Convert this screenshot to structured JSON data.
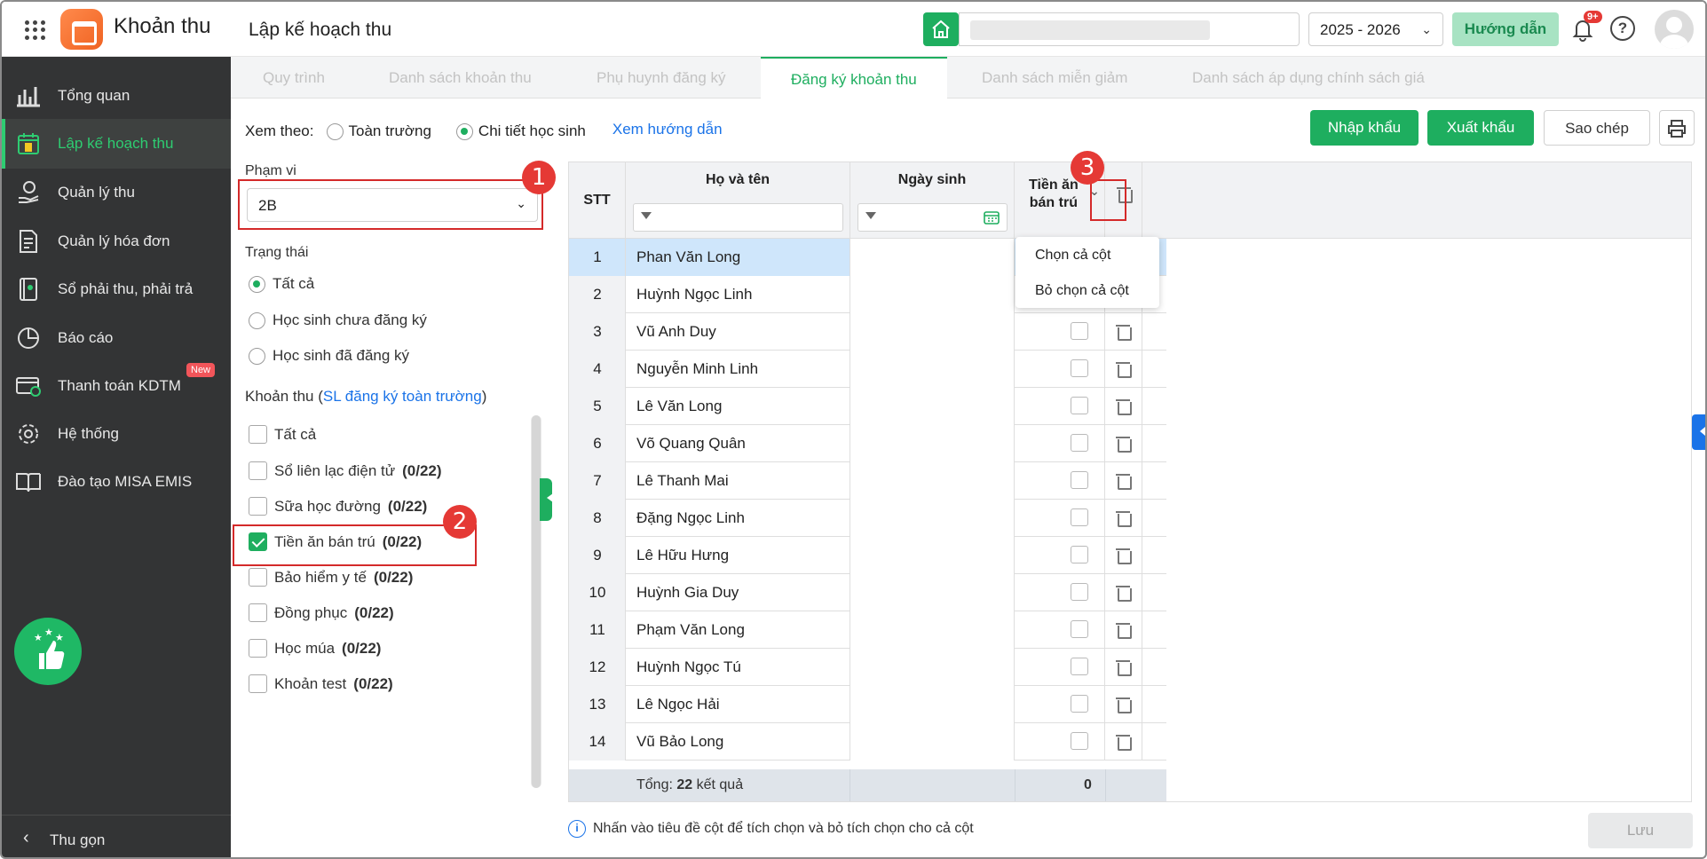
{
  "app": {
    "name": "Khoản thu",
    "page_title": "Lập kế hoạch thu",
    "school_year": "2025 - 2026",
    "guide_label": "Hướng dẫn",
    "notif_badge": "9+"
  },
  "sidebar": {
    "items": [
      {
        "label": "Tổng quan",
        "icon": "chart-bars-icon"
      },
      {
        "label": "Lập kế hoạch thu",
        "icon": "calendar-dollar-icon",
        "active": true
      },
      {
        "label": "Quản lý thu",
        "icon": "hand-coin-icon"
      },
      {
        "label": "Quản lý hóa đơn",
        "icon": "invoice-icon"
      },
      {
        "label": "Sổ phải thu, phải trả",
        "icon": "ledger-icon"
      },
      {
        "label": "Báo cáo",
        "icon": "pie-chart-icon"
      },
      {
        "label": "Thanh toán KDTM",
        "icon": "card-payment-icon",
        "badge": "New"
      },
      {
        "label": "Hệ thống",
        "icon": "gear-icon"
      },
      {
        "label": "Đào tạo MISA EMIS",
        "icon": "book-icon"
      }
    ],
    "collapse_label": "Thu gọn"
  },
  "tabs": [
    "Quy trình",
    "Danh sách khoản thu",
    "Phụ huynh đăng ký",
    "Đăng ký khoản thu",
    "Danh sách miễn giảm",
    "Danh sách áp dụng chính sách giá"
  ],
  "filters": {
    "view_by_label": "Xem theo:",
    "view_all": "Toàn trường",
    "view_detail": "Chi tiết học sinh",
    "guide_link": "Xem hướng dẫn",
    "scope_label": "Phạm vi",
    "scope_value": "2B",
    "status_label": "Trạng thái",
    "status_options": [
      "Tất cả",
      "Học sinh chưa đăng ký",
      "Học sinh đã đăng ký"
    ],
    "fees_label": "Khoản thu (",
    "fees_link": "SL đăng ký toàn trường",
    "fees_label_end": ")",
    "fee_all": "Tất cả",
    "fees": [
      {
        "name": "Sổ liên lạc điện tử",
        "count": "(0/22)"
      },
      {
        "name": "Sữa học đường",
        "count": "(0/22)"
      },
      {
        "name": "Tiền ăn bán trú",
        "count": "(0/22)",
        "checked": true
      },
      {
        "name": "Bảo hiểm y tế",
        "count": "(0/22)"
      },
      {
        "name": "Đồng phục",
        "count": "(0/22)"
      },
      {
        "name": "Học múa",
        "count": "(0/22)"
      },
      {
        "name": "Khoản test",
        "count": "(0/22)"
      }
    ]
  },
  "actions": {
    "import": "Nhập khẩu",
    "export": "Xuất khẩu",
    "copy": "Sao chép"
  },
  "table": {
    "headers": {
      "stt": "STT",
      "name": "Họ và tên",
      "dob": "Ngày sinh",
      "fee_line1": "Tiền ăn",
      "fee_line2": "bán trú"
    },
    "rows": [
      "Phan Văn Long",
      "Huỳnh Ngọc Linh",
      "Vũ Anh Duy",
      "Nguyễn Minh Linh",
      "Lê Văn Long",
      "Võ Quang Quân",
      "Lê Thanh Mai",
      "Đặng Ngọc Linh",
      "Lê Hữu Hưng",
      "Huỳnh Gia Duy",
      "Phạm Văn Long",
      "Huỳnh Ngọc Tú",
      "Lê Ngọc Hải",
      "Vũ Bảo Long"
    ],
    "footer_prefix": "Tổng: ",
    "footer_count": "22",
    "footer_suffix": " kết quả",
    "footer_total": "0"
  },
  "dropdown": {
    "select_all": "Chọn cả cột",
    "deselect_all": "Bỏ chọn cả cột"
  },
  "callouts": [
    "1",
    "2",
    "3"
  ],
  "note": "Nhấn vào tiêu đề cột để tích chọn và bỏ tích chọn cho cả cột",
  "save_label": "Lưu",
  "colors": {
    "accent": "#1eae5f",
    "callout": "#e53935",
    "link": "#1a73e8"
  }
}
